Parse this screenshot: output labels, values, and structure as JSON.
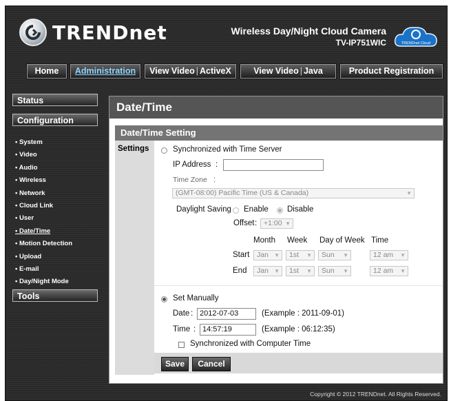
{
  "header": {
    "logo_text": "TRENDnet",
    "product_name": "Wireless Day/Night Cloud Camera",
    "model": "TV-IP751WIC",
    "cloud_badge": "TRENDnet Cloud"
  },
  "nav": {
    "home": "Home",
    "administration": "Administration",
    "view_video_activex_a": "View Video",
    "view_video_activex_b": "ActiveX",
    "view_video_java_a": "View Video",
    "view_video_java_b": "Java",
    "product_registration": "Product Registration"
  },
  "sidebar": {
    "status": "Status",
    "configuration": "Configuration",
    "tools": "Tools",
    "items": [
      "• System",
      "• Video",
      "• Audio",
      "• Wireless",
      "• Network",
      "• Cloud Link",
      "• User",
      "• Date/Time",
      "• Motion Detection",
      "• Upload",
      "• E-mail",
      "• Day/Night Mode"
    ]
  },
  "main": {
    "page_title": "Date/Time",
    "section_title": "Date/Time Setting",
    "settings_label": "Settings",
    "sync_server_label": "Synchronized with Time Server",
    "ip_address_label": "IP Address",
    "ip_address_colon": ":",
    "ip_address_value": "",
    "time_zone_label": "Time Zone",
    "time_zone_colon": ":",
    "time_zone_value": "(GMT-08:00) Pacific Time (US & Canada)",
    "daylight_saving_label": "Daylight Saving",
    "enable_label": "Enable",
    "disable_label": "Disable",
    "offset_label": "Offset",
    "offset_colon": ":",
    "offset_value": "+1:00",
    "col_month": "Month",
    "col_week": "Week",
    "col_day": "Day of Week",
    "col_time": "Time",
    "start_label": "Start",
    "end_label": "End",
    "start": {
      "month": "Jan",
      "week": "1st",
      "day": "Sun",
      "time": "12 am"
    },
    "end": {
      "month": "Jan",
      "week": "1st",
      "day": "Sun",
      "time": "12 am"
    },
    "set_manually_label": "Set Manually",
    "date_label": "Date",
    "time_label": "Time",
    "colon": ":",
    "date_value": "2012-07-03",
    "date_example": "(Example : 2011-09-01)",
    "time_value": "14:57:19",
    "time_example": "(Example : 06:12:35)",
    "sync_computer_label": "Synchronized with Computer Time",
    "save": "Save",
    "cancel": "Cancel"
  },
  "footer": {
    "copyright": "Copyright © 2012 TRENDnet.  All Rights Reserved."
  },
  "colors": {
    "background": "#2a2a2a",
    "title_bar": "#555555",
    "section_bar": "#747474",
    "link_active": "#8fd3ff"
  }
}
